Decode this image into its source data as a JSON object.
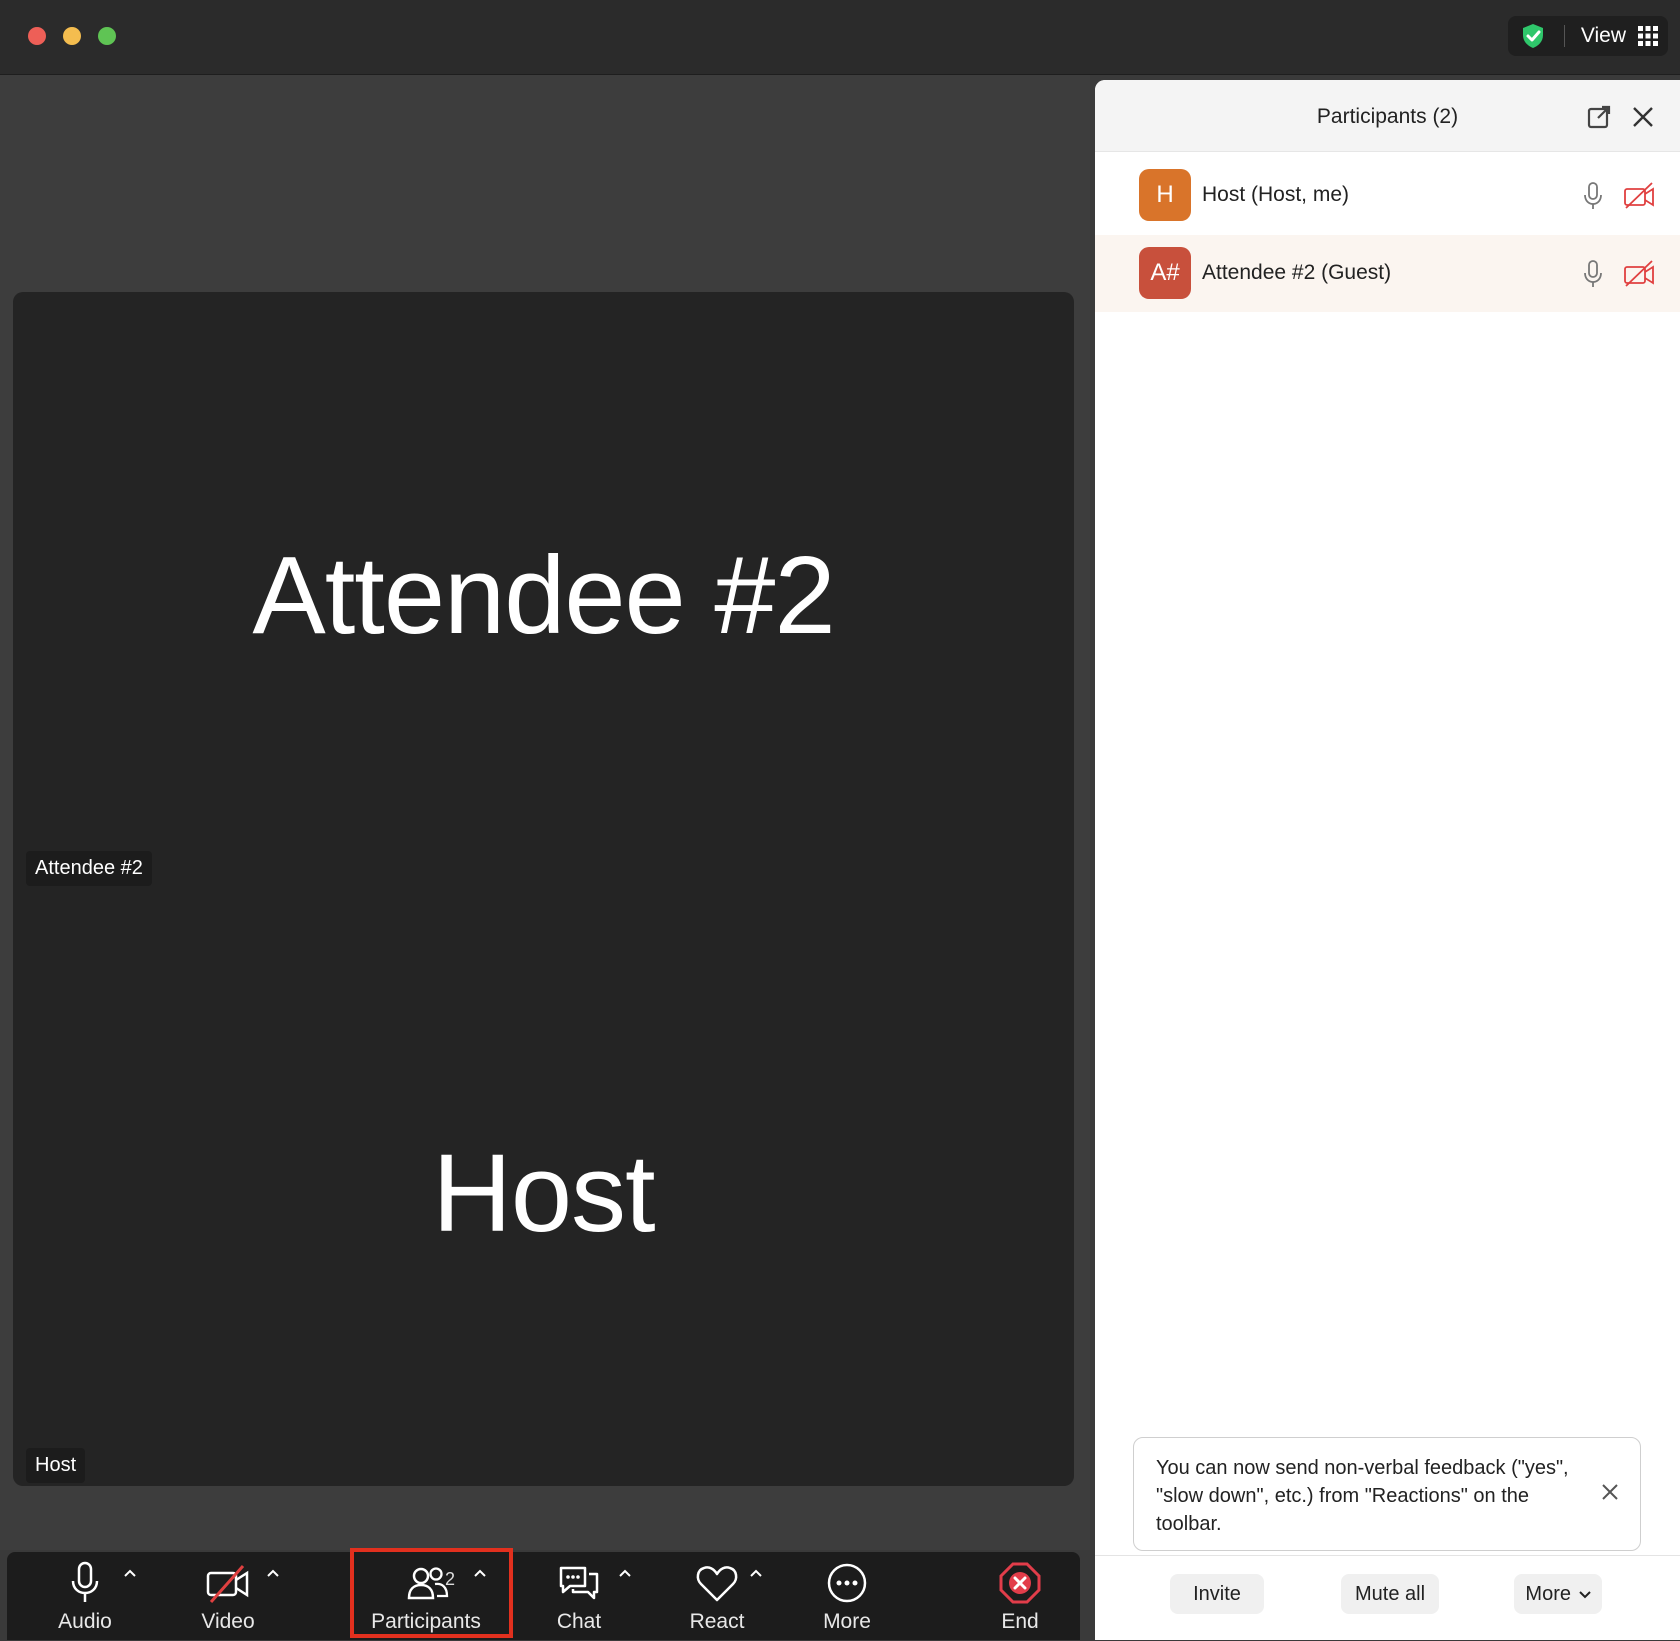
{
  "window": {
    "view_label": "View",
    "icons": [
      "shield-check-icon",
      "grid-icon"
    ]
  },
  "video": {
    "tile_top_name": "Attendee #2",
    "tile_bottom_name": "Host",
    "tag_top": "Attendee #2",
    "tag_bottom": "Host"
  },
  "toolbar": {
    "audio": "Audio",
    "video": "Video",
    "participants": "Participants",
    "participants_count": "2",
    "chat": "Chat",
    "react": "React",
    "more": "More",
    "end": "End"
  },
  "participants_panel": {
    "title": "Participants (2)",
    "items": [
      {
        "avatar": "H",
        "name": "Host (Host, me)",
        "avatar_color": "#d9742a"
      },
      {
        "avatar": "A#",
        "name": "Attendee #2 (Guest)",
        "avatar_color": "#c8503c"
      }
    ],
    "tip": "You can now send non-verbal feedback (\"yes\", \"slow down\", etc.) from \"Reactions\" on the toolbar.",
    "buttons": {
      "invite": "Invite",
      "mute_all": "Mute all",
      "more": "More"
    }
  },
  "colors": {
    "highlight": "#e2301e",
    "end_red": "#e23d4a",
    "video_off_red": "#e04040",
    "shield_green": "#2fc76b"
  }
}
